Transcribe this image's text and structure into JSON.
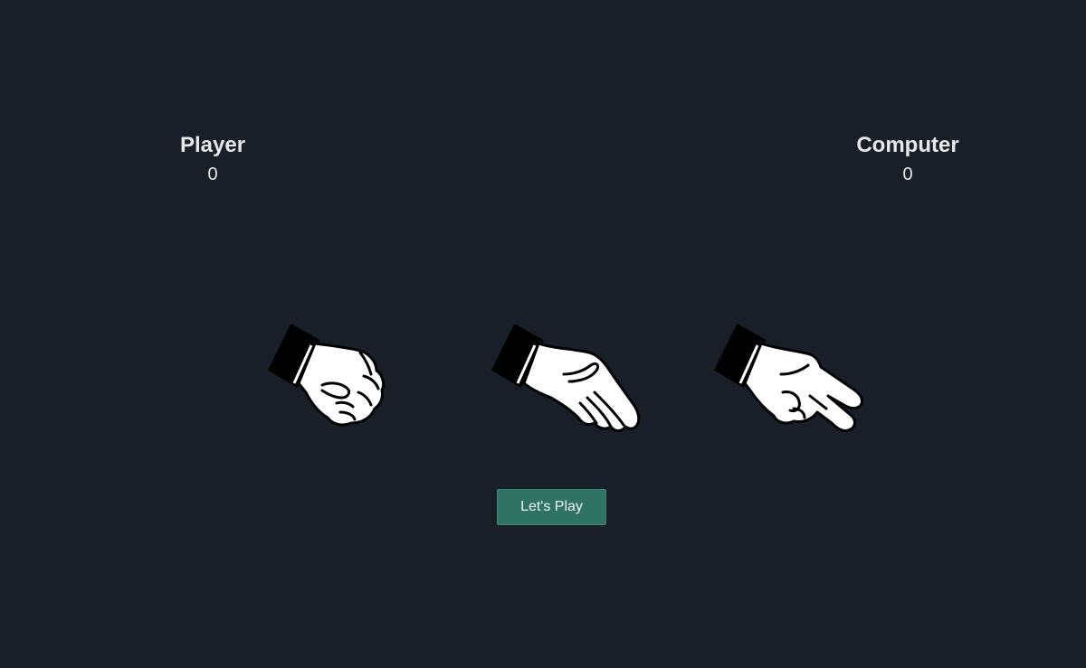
{
  "player": {
    "title": "Player",
    "score": "0"
  },
  "computer": {
    "title": "Computer",
    "score": "0"
  },
  "choices": [
    {
      "name": "rock",
      "icon": "rock-hand-icon"
    },
    {
      "name": "paper",
      "icon": "paper-hand-icon"
    },
    {
      "name": "scissors",
      "icon": "scissors-hand-icon"
    }
  ],
  "play_button": {
    "label": "Let's Play",
    "color": "#2f7462"
  },
  "colors": {
    "background": "#181f29",
    "text": "#e8e8e8"
  }
}
